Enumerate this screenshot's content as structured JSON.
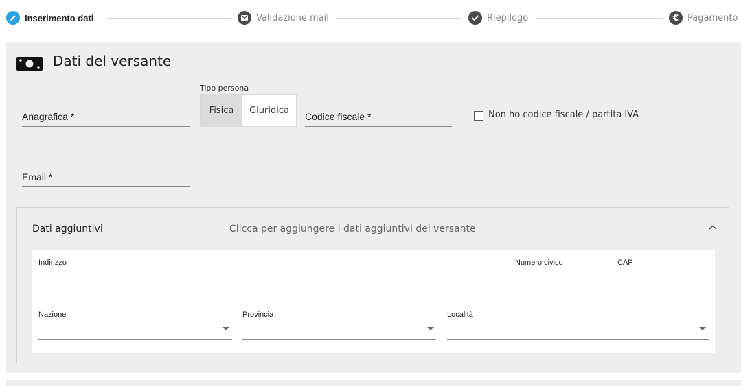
{
  "stepper": {
    "steps": [
      {
        "label": "Inserimento dati",
        "icon": "pencil-icon",
        "active": true
      },
      {
        "label": "Validazione mail",
        "icon": "envelope-icon",
        "active": false
      },
      {
        "label": "Riepilogo",
        "icon": "check-icon",
        "active": false
      },
      {
        "label": "Pagamento",
        "icon": "euro-icon",
        "active": false
      }
    ],
    "active_color": "#2aa3df",
    "inactive_color": "#4a4a4a"
  },
  "section": {
    "icon": "money-bill-icon",
    "title": "Dati del versante"
  },
  "form": {
    "anagrafica_label": "Anagrafica *",
    "tipo_persona_label": "Tipo persona",
    "tipo_persona_options": [
      "Fisica",
      "Giuridica"
    ],
    "tipo_persona_selected": "Fisica",
    "codice_fiscale_label": "Codice fiscale *",
    "no_cf_checkbox_label": "Non ho codice fiscale / partita IVA",
    "email_label": "Email *"
  },
  "additional": {
    "title": "Dati aggiuntivi",
    "hint": "Clicca per aggiungere i dati aggiuntivi del versante",
    "collapse_icon": "chevron-up-icon",
    "fields": {
      "indirizzo": "Indirizzo",
      "numero_civico": "Numero civico",
      "cap": "CAP",
      "nazione": "Nazione",
      "provincia": "Provincia",
      "localita": "Località"
    }
  }
}
